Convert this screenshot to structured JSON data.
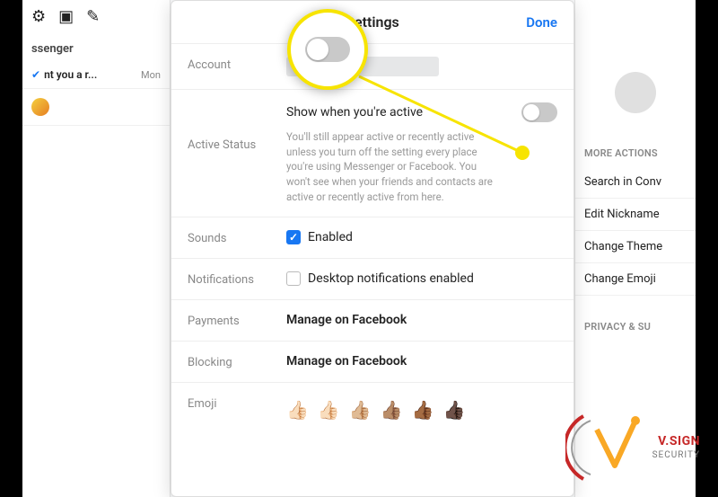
{
  "header": {
    "title": "Settings",
    "done": "Done"
  },
  "rows": {
    "account": {
      "label": "Account"
    },
    "activeStatus": {
      "label": "Active Status",
      "title": "Show when you're active",
      "desc": "You'll still appear active or recently active unless you turn off the setting every place you're using Messenger or Facebook. You won't see when your friends and contacts are active or recently active from here."
    },
    "sounds": {
      "label": "Sounds",
      "value": "Enabled"
    },
    "notifications": {
      "label": "Notifications",
      "value": "Desktop notifications enabled"
    },
    "payments": {
      "label": "Payments",
      "value": "Manage on Facebook"
    },
    "blocking": {
      "label": "Blocking",
      "value": "Manage on Facebook"
    },
    "emoji": {
      "label": "Emoji"
    }
  },
  "emojiThumbs": [
    "👍🏻",
    "👍🏻",
    "👍🏼",
    "👍🏽",
    "👍🏾",
    "👍🏿"
  ],
  "sidebar": {
    "appLabel": "ssenger",
    "conv": {
      "text": "nt you a r...",
      "time": "Mon"
    }
  },
  "rightPanel": {
    "section1": "MORE ACTIONS",
    "links": [
      "Search in Conv",
      "Edit Nickname",
      "Change Theme",
      "Change Emoji"
    ],
    "section2": "PRIVACY & SU"
  },
  "logo": {
    "brand": "V.SIGN",
    "sub": "SECURITY"
  }
}
